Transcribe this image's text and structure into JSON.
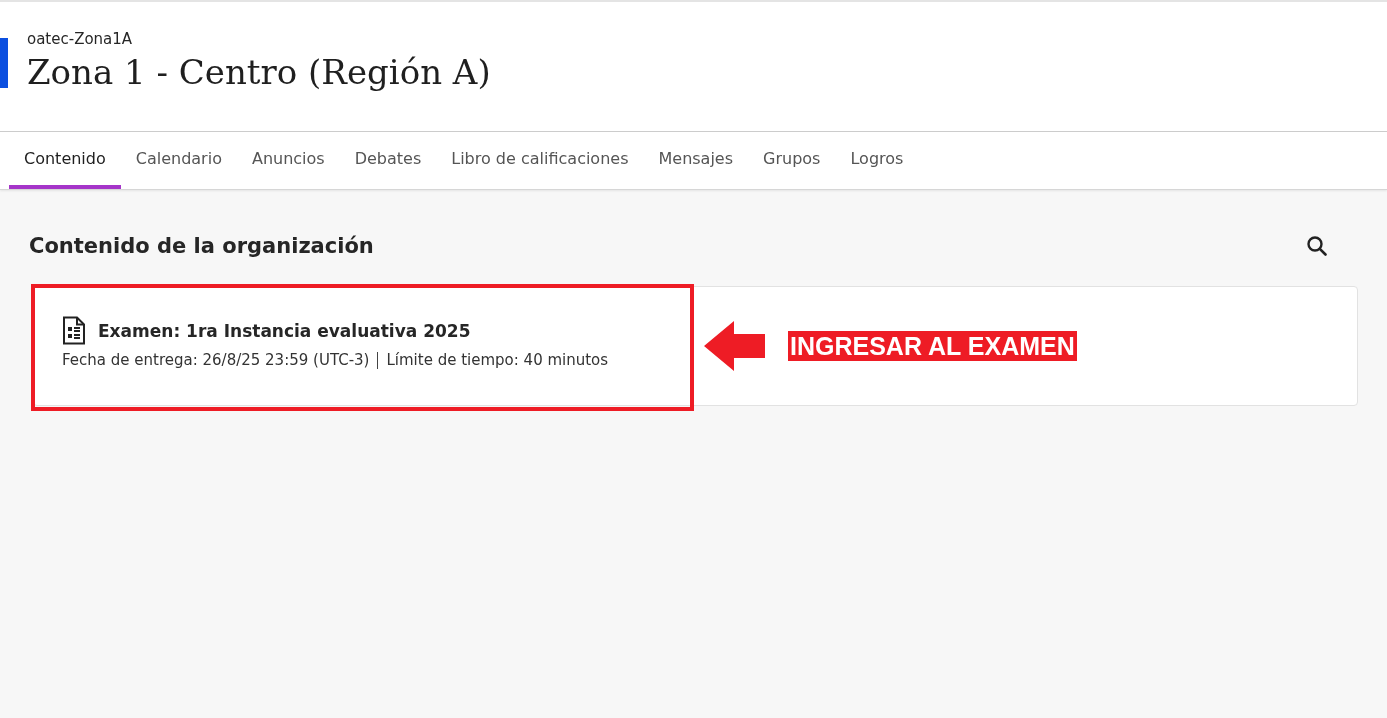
{
  "header": {
    "subtitle": "oatec-Zona1A",
    "title": "Zona 1 - Centro (Región A)"
  },
  "tabs": [
    {
      "label": "Contenido",
      "selected": true
    },
    {
      "label": "Calendario",
      "selected": false
    },
    {
      "label": "Anuncios",
      "selected": false
    },
    {
      "label": "Debates",
      "selected": false
    },
    {
      "label": "Libro de calificaciones",
      "selected": false
    },
    {
      "label": "Mensajes",
      "selected": false
    },
    {
      "label": "Grupos",
      "selected": false
    },
    {
      "label": "Logros",
      "selected": false
    }
  ],
  "content": {
    "heading": "Contenido de la organización",
    "items": [
      {
        "title": "Examen: 1ra Instancia evaluativa 2025",
        "due": "Fecha de entrega: 26/8/25 23:59 (UTC-3)",
        "time_limit": "Límite de tiempo: 40 minutos"
      }
    ]
  },
  "annotation": {
    "label": "INGRESAR AL EXAMEN"
  }
}
